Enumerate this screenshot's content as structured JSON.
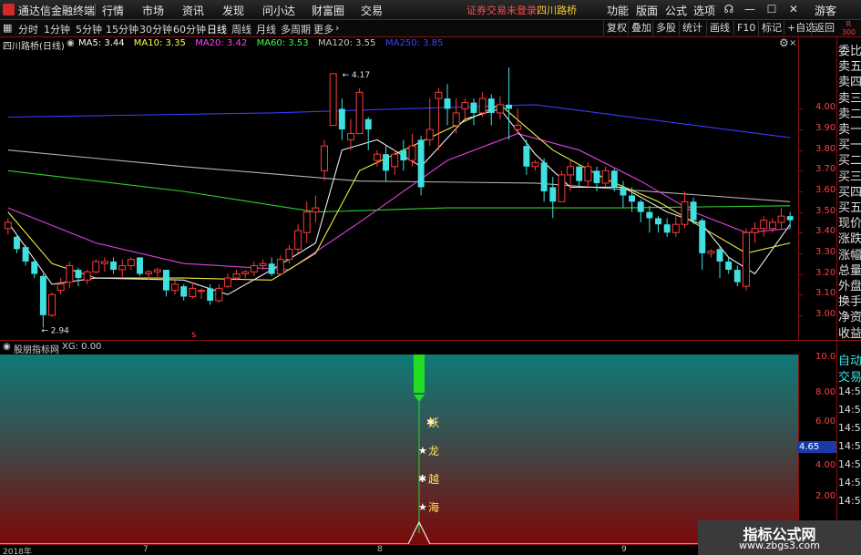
{
  "app": {
    "name": "通达信金融终端",
    "menu": [
      "行情",
      "市场",
      "资讯",
      "发现",
      "问小达",
      "财富圈",
      "交易"
    ],
    "notice": "证券交易未登录",
    "stock_link": "四川路桥",
    "right_menu": [
      "功能",
      "版面",
      "公式",
      "选项"
    ],
    "guest": "游客"
  },
  "toolbar": {
    "periods": [
      "分时",
      "1分钟",
      "5分钟",
      "15分钟",
      "30分钟",
      "60分钟",
      "日线",
      "周线",
      "月线",
      "多周期",
      "更多"
    ],
    "active_period": "日线",
    "right_buttons": [
      "复权",
      "叠加",
      "多股",
      "统计",
      "画线",
      "F10",
      "标记",
      "+自选",
      "返回"
    ],
    "side_top": "R",
    "side_bottom": "300"
  },
  "main_chart": {
    "title": "四川路桥(日线)",
    "ma": [
      {
        "label": "MA5:",
        "value": "3.44",
        "color": "#ffffff"
      },
      {
        "label": "MA10:",
        "value": "3.35",
        "color": "#ffff40"
      },
      {
        "label": "MA20:",
        "value": "3.42",
        "color": "#ff40ff"
      },
      {
        "label": "MA60:",
        "value": "3.53",
        "color": "#40ff40"
      },
      {
        "label": "MA120:",
        "value": "3.55",
        "color": "#c8c8c8"
      },
      {
        "label": "MA250:",
        "value": "3.85",
        "color": "#4040ff"
      }
    ],
    "high_label": "4.17",
    "low_label": "2.94",
    "marker": "s",
    "yticks": [
      "4.00",
      "3.90",
      "3.80",
      "3.70",
      "3.60",
      "3.50",
      "3.40",
      "3.30",
      "3.20",
      "3.10",
      "3.00"
    ]
  },
  "indicator": {
    "title": "股朋指标网",
    "xg": "XG: 0.00",
    "yticks": [
      "10.00",
      "8.00",
      "6.00",
      "4.00",
      "2.00"
    ],
    "price_flag": "4.65",
    "tags": [
      "妖",
      "龙",
      "越",
      "海"
    ]
  },
  "right_panel": {
    "labels": [
      "委比",
      "卖五",
      "卖四",
      "卖三",
      "卖二",
      "卖一",
      "买一",
      "买二",
      "买三",
      "买四",
      "买五",
      "现价",
      "涨跌",
      "涨幅",
      "总量",
      "外盘",
      "换手",
      "净资",
      "收益"
    ],
    "bottom_labels": [
      "自动",
      "交易"
    ],
    "times": [
      "14:56",
      "14:56",
      "14:56",
      "14:56",
      "14:56",
      "14:56",
      "14:56"
    ]
  },
  "date_axis": [
    "2018年",
    "7",
    "8",
    "9"
  ],
  "watermark": {
    "line1": "指标公式网",
    "line2": "www.zbgs3.com"
  },
  "colors": {
    "up": "#ff3a3a",
    "down": "#40e0e0",
    "grid_red": "#8a1010",
    "signal_green": "#22dd22"
  },
  "chart_data": {
    "type": "candlestick",
    "title": "四川路桥(日线)",
    "ylim": [
      2.88,
      4.28
    ],
    "candles": [
      [
        3.42,
        3.45,
        3.39,
        3.47
      ],
      [
        3.38,
        3.32,
        3.3,
        3.39
      ],
      [
        3.33,
        3.26,
        3.24,
        3.34
      ],
      [
        3.26,
        3.2,
        3.18,
        3.27
      ],
      [
        3.19,
        3.0,
        2.94,
        3.2
      ],
      [
        3.0,
        3.1,
        2.99,
        3.11
      ],
      [
        3.12,
        3.15,
        3.1,
        3.18
      ],
      [
        3.16,
        3.24,
        3.13,
        3.26
      ],
      [
        3.22,
        3.18,
        3.14,
        3.23
      ],
      [
        3.17,
        3.21,
        3.15,
        3.22
      ],
      [
        3.21,
        3.26,
        3.2,
        3.27
      ],
      [
        3.25,
        3.26,
        3.21,
        3.28
      ],
      [
        3.26,
        3.22,
        3.2,
        3.28
      ],
      [
        3.22,
        3.24,
        3.18,
        3.27
      ],
      [
        3.24,
        3.27,
        3.22,
        3.28
      ],
      [
        3.28,
        3.2,
        3.19,
        3.28
      ],
      [
        3.2,
        3.21,
        3.17,
        3.22
      ],
      [
        3.21,
        3.22,
        3.18,
        3.23
      ],
      [
        3.22,
        3.12,
        3.09,
        3.22
      ],
      [
        3.12,
        3.15,
        3.1,
        3.17
      ],
      [
        3.14,
        3.09,
        3.07,
        3.15
      ],
      [
        3.09,
        3.13,
        3.08,
        3.16
      ],
      [
        3.12,
        3.12,
        3.08,
        3.13
      ],
      [
        3.13,
        3.07,
        3.05,
        3.15
      ],
      [
        3.07,
        3.13,
        3.06,
        3.15
      ],
      [
        3.14,
        3.18,
        3.13,
        3.2
      ],
      [
        3.18,
        3.2,
        3.17,
        3.22
      ],
      [
        3.2,
        3.21,
        3.18,
        3.22
      ],
      [
        3.21,
        3.24,
        3.19,
        3.26
      ],
      [
        3.24,
        3.25,
        3.22,
        3.27
      ],
      [
        3.25,
        3.2,
        3.19,
        3.28
      ],
      [
        3.2,
        3.27,
        3.19,
        3.29
      ],
      [
        3.27,
        3.32,
        3.25,
        3.34
      ],
      [
        3.32,
        3.41,
        3.3,
        3.44
      ],
      [
        3.4,
        3.5,
        3.35,
        3.55
      ],
      [
        3.5,
        3.52,
        3.45,
        3.58
      ],
      [
        3.7,
        3.82,
        3.65,
        3.85
      ],
      [
        3.92,
        4.17,
        3.92,
        4.17
      ],
      [
        4.0,
        3.9,
        3.85,
        4.05
      ],
      [
        3.85,
        3.88,
        3.8,
        3.95
      ],
      [
        3.88,
        4.08,
        3.88,
        4.1
      ],
      [
        3.95,
        3.9,
        3.8,
        3.96
      ],
      [
        3.75,
        3.78,
        3.72,
        3.8
      ],
      [
        3.78,
        3.7,
        3.65,
        3.82
      ],
      [
        3.72,
        3.78,
        3.68,
        3.8
      ],
      [
        3.8,
        3.75,
        3.7,
        3.85
      ],
      [
        3.75,
        3.82,
        3.72,
        3.88
      ],
      [
        3.85,
        3.62,
        3.58,
        3.87
      ],
      [
        3.85,
        3.9,
        3.82,
        4.05
      ],
      [
        4.05,
        4.08,
        3.8,
        4.1
      ],
      [
        4.05,
        4.0,
        3.92,
        4.12
      ],
      [
        3.92,
        3.98,
        3.88,
        4.05
      ],
      [
        4.0,
        4.03,
        3.95,
        4.05
      ],
      [
        4.03,
        3.98,
        3.92,
        4.05
      ],
      [
        3.98,
        4.05,
        3.96,
        4.08
      ],
      [
        4.05,
        3.98,
        3.92,
        4.07
      ],
      [
        3.98,
        4.02,
        3.95,
        4.06
      ],
      [
        4.02,
        4.0,
        3.85,
        4.2
      ],
      [
        3.9,
        3.92,
        3.88,
        4.0
      ],
      [
        3.82,
        3.72,
        3.68,
        3.85
      ],
      [
        3.72,
        3.74,
        3.7,
        3.75
      ],
      [
        3.74,
        3.6,
        3.55,
        3.76
      ],
      [
        3.62,
        3.55,
        3.47,
        3.67
      ],
      [
        3.55,
        3.68,
        3.55,
        3.7
      ],
      [
        3.68,
        3.72,
        3.6,
        3.75
      ],
      [
        3.72,
        3.65,
        3.62,
        3.73
      ],
      [
        3.65,
        3.72,
        3.62,
        3.74
      ],
      [
        3.7,
        3.64,
        3.6,
        3.72
      ],
      [
        3.64,
        3.7,
        3.62,
        3.72
      ],
      [
        3.7,
        3.62,
        3.6,
        3.71
      ],
      [
        3.62,
        3.58,
        3.52,
        3.65
      ],
      [
        3.58,
        3.55,
        3.5,
        3.62
      ],
      [
        3.55,
        3.5,
        3.45,
        3.56
      ],
      [
        3.5,
        3.47,
        3.4,
        3.53
      ],
      [
        3.47,
        3.44,
        3.4,
        3.48
      ],
      [
        3.44,
        3.4,
        3.38,
        3.47
      ],
      [
        3.4,
        3.44,
        3.38,
        3.48
      ],
      [
        3.44,
        3.55,
        3.42,
        3.6
      ],
      [
        3.55,
        3.46,
        3.44,
        3.57
      ],
      [
        3.46,
        3.3,
        3.22,
        3.47
      ],
      [
        3.3,
        3.31,
        3.28,
        3.32
      ],
      [
        3.32,
        3.26,
        3.18,
        3.33
      ],
      [
        3.26,
        3.22,
        3.2,
        3.28
      ],
      [
        3.22,
        3.16,
        3.14,
        3.24
      ],
      [
        3.14,
        3.4,
        3.12,
        3.42
      ],
      [
        3.4,
        3.42,
        3.35,
        3.45
      ],
      [
        3.42,
        3.46,
        3.38,
        3.48
      ],
      [
        3.42,
        3.45,
        3.4,
        3.47
      ],
      [
        3.45,
        3.48,
        3.42,
        3.52
      ],
      [
        3.48,
        3.46,
        3.42,
        3.5
      ]
    ],
    "ma_series": [
      {
        "name": "MA250",
        "color": "#3a3aff",
        "points": [
          [
            0,
            3.96
          ],
          [
            30,
            3.98
          ],
          [
            60,
            4.02
          ],
          [
            89,
            3.86
          ]
        ]
      },
      {
        "name": "MA120",
        "color": "#b4b4b4",
        "points": [
          [
            0,
            3.8
          ],
          [
            20,
            3.72
          ],
          [
            40,
            3.65
          ],
          [
            60,
            3.64
          ],
          [
            89,
            3.55
          ]
        ]
      },
      {
        "name": "MA60",
        "color": "#30d030",
        "points": [
          [
            0,
            3.7
          ],
          [
            20,
            3.6
          ],
          [
            35,
            3.5
          ],
          [
            50,
            3.52
          ],
          [
            70,
            3.52
          ],
          [
            89,
            3.53
          ]
        ]
      },
      {
        "name": "MA20",
        "color": "#e040e0",
        "points": [
          [
            0,
            3.52
          ],
          [
            10,
            3.35
          ],
          [
            20,
            3.25
          ],
          [
            32,
            3.22
          ],
          [
            40,
            3.45
          ],
          [
            50,
            3.75
          ],
          [
            58,
            3.88
          ],
          [
            65,
            3.8
          ],
          [
            72,
            3.65
          ],
          [
            78,
            3.5
          ],
          [
            84,
            3.4
          ],
          [
            89,
            3.42
          ]
        ]
      },
      {
        "name": "MA10",
        "color": "#f0f040",
        "points": [
          [
            0,
            3.5
          ],
          [
            5,
            3.25
          ],
          [
            10,
            3.18
          ],
          [
            20,
            3.18
          ],
          [
            30,
            3.17
          ],
          [
            35,
            3.3
          ],
          [
            40,
            3.7
          ],
          [
            45,
            3.8
          ],
          [
            50,
            3.9
          ],
          [
            56,
            4.02
          ],
          [
            62,
            3.8
          ],
          [
            68,
            3.66
          ],
          [
            74,
            3.55
          ],
          [
            80,
            3.4
          ],
          [
            84,
            3.3
          ],
          [
            89,
            3.35
          ]
        ]
      },
      {
        "name": "MA5",
        "color": "#e8e8e8",
        "points": [
          [
            0,
            3.45
          ],
          [
            5,
            3.15
          ],
          [
            10,
            3.18
          ],
          [
            20,
            3.17
          ],
          [
            25,
            3.1
          ],
          [
            30,
            3.22
          ],
          [
            35,
            3.35
          ],
          [
            38,
            3.8
          ],
          [
            42,
            3.85
          ],
          [
            47,
            3.72
          ],
          [
            52,
            3.95
          ],
          [
            56,
            4.0
          ],
          [
            60,
            3.78
          ],
          [
            64,
            3.62
          ],
          [
            70,
            3.62
          ],
          [
            75,
            3.5
          ],
          [
            79,
            3.44
          ],
          [
            82,
            3.28
          ],
          [
            85,
            3.2
          ],
          [
            89,
            3.44
          ]
        ]
      }
    ]
  }
}
